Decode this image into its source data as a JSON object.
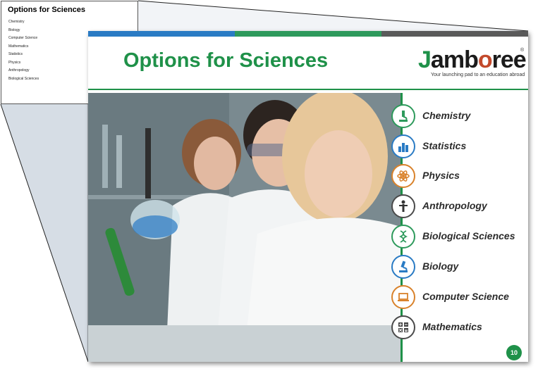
{
  "outline": {
    "title": "Options for Sciences",
    "items": [
      "Chemistry",
      "Biology",
      "Computer Science",
      "Mathematics",
      "Statistics",
      "Physics",
      "Anthropology",
      "Biological Sciences"
    ]
  },
  "slide": {
    "title": "Options for Sciences",
    "logo": {
      "text": "Jamboree",
      "registered": "®",
      "tagline": "Your launching pad to an education abroad"
    },
    "page_number": "10",
    "topics": [
      {
        "label": "Chemistry",
        "icon": "microscope-icon",
        "color": "#2e9a5c"
      },
      {
        "label": "Statistics",
        "icon": "bar-chart-icon",
        "color": "#2a7bc4"
      },
      {
        "label": "Physics",
        "icon": "atom-icon",
        "color": "#d9822b"
      },
      {
        "label": "Anthropology",
        "icon": "person-icon",
        "color": "#4a4a4a"
      },
      {
        "label": "Biological Sciences",
        "icon": "dna-icon",
        "color": "#2e9a5c"
      },
      {
        "label": "Biology",
        "icon": "microscope-icon",
        "color": "#2a7bc4"
      },
      {
        "label": "Computer Science",
        "icon": "laptop-icon",
        "color": "#d9822b"
      },
      {
        "label": "Mathematics",
        "icon": "calculator-icon",
        "color": "#4a4a4a"
      }
    ]
  },
  "colors": {
    "brand_green": "#1f9149",
    "bar_blue": "#2a7bc4",
    "bar_green": "#2e9a5c",
    "bar_gray": "#5a5a5a"
  }
}
